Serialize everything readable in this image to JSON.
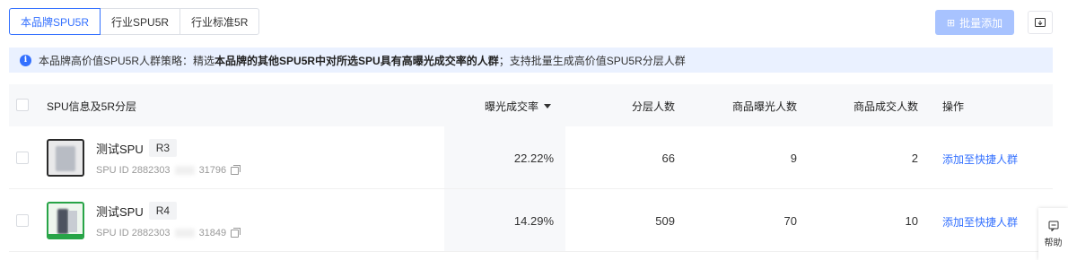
{
  "tabs": [
    {
      "label": "本品牌SPU5R",
      "active": true
    },
    {
      "label": "行业SPU5R",
      "active": false
    },
    {
      "label": "行业标准5R",
      "active": false
    }
  ],
  "toolbar": {
    "batch_add_label": "批量添加",
    "batch_add_icon": "plus-square-icon",
    "export_icon": "download-box-icon"
  },
  "info": {
    "icon": "info-icon",
    "prefix": "本品牌高价值SPU5R人群策略：精选",
    "bold": "本品牌的其他SPU5R中对所选SPU具有高曝光成交率的人群",
    "suffix": "；支持批量生成高价值SPU5R分层人群"
  },
  "table": {
    "columns": {
      "spu": "SPU信息及5R分层",
      "rate": "曝光成交率",
      "layer": "分层人数",
      "exposure": "商品曝光人数",
      "deal": "商品成交人数",
      "op": "操作"
    },
    "rows": [
      {
        "name": "测试SPU",
        "tag": "R3",
        "id_prefix": "SPU ID 2882303",
        "id_suffix": "31796",
        "rate": "22.22%",
        "layer": "66",
        "exposure": "9",
        "deal": "2",
        "action": "添加至快捷人群"
      },
      {
        "name": "测试SPU",
        "tag": "R4",
        "id_prefix": "SPU ID 2882303",
        "id_suffix": "31849",
        "rate": "14.29%",
        "layer": "509",
        "exposure": "70",
        "deal": "10",
        "action": "添加至快捷人群"
      }
    ]
  },
  "help": {
    "label": "帮助",
    "icon": "help-chat-icon"
  },
  "colors": {
    "accent": "#3370ff",
    "info_bg": "#eaf1ff",
    "disabled_btn": "#a8c3ff"
  }
}
